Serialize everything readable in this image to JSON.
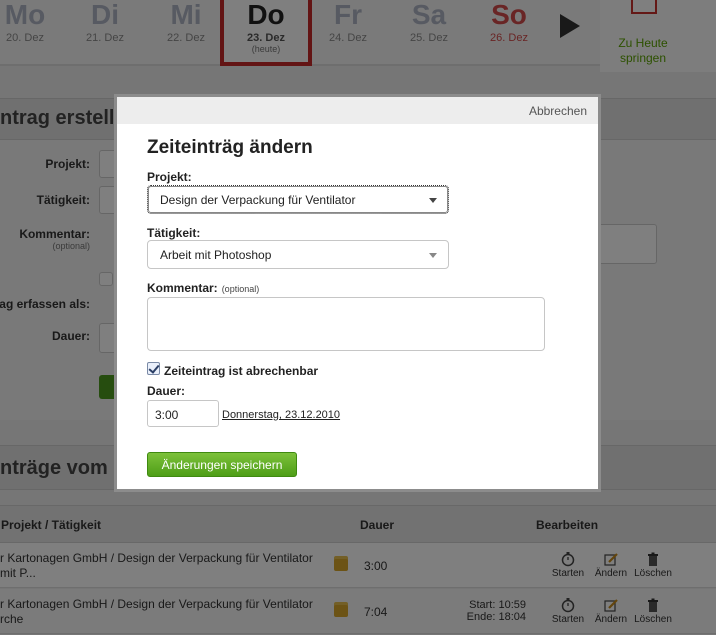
{
  "days": [
    {
      "name": "Mo",
      "date": "20. Dez"
    },
    {
      "name": "Di",
      "date": "21. Dez"
    },
    {
      "name": "Mi",
      "date": "22. Dez"
    },
    {
      "name": "Do",
      "date": "23. Dez",
      "sub": "(heute)"
    },
    {
      "name": "Fr",
      "date": "24. Dez"
    },
    {
      "name": "Sa",
      "date": "25. Dez"
    },
    {
      "name": "So",
      "date": "26. Dez"
    }
  ],
  "today_link": "Zu Heute springen",
  "bg_form": {
    "heading": "ntrag erstelle",
    "labels": {
      "project": "Projekt:",
      "activity": "Tätigkeit:",
      "comment": "Kommentar:",
      "comment_hint": "(optional)",
      "record_as": "ag erfassen als:",
      "duration": "Dauer:"
    }
  },
  "entries_heading": "nträge vom D",
  "table": {
    "headers": {
      "project": "Projekt / Tätigkeit",
      "duration": "Dauer",
      "edit": "Bearbeiten"
    },
    "rows": [
      {
        "project": "r Kartonagen GmbH / Design der Verpackung für Ventilator mit P...",
        "duration": "3:00",
        "start": "",
        "end": ""
      },
      {
        "project": "r Kartonagen GmbH / Design der Verpackung für Ventilator rche",
        "duration": "7:04",
        "start": "Start: 10:59",
        "end": "Ende: 18:04"
      }
    ],
    "actions": {
      "start": "Starten",
      "edit": "Ändern",
      "delete": "Löschen"
    }
  },
  "modal": {
    "cancel": "Abbrechen",
    "title": "Zeiteinträg ändern",
    "project_label": "Projekt:",
    "project_value": "Design der Verpackung für Ventilator",
    "activity_label": "Tätigkeit:",
    "activity_value": "Arbeit mit Photoshop",
    "comment_label": "Kommentar:",
    "comment_hint": "(optional)",
    "comment_value": "",
    "billable_label": "Zeiteintrag ist abrechenbar",
    "billable_checked": true,
    "duration_label": "Dauer:",
    "duration_value": "3:00",
    "date_link": "Donnerstag, 23.12.2010",
    "save_label": "Änderungen speichern"
  },
  "colors": {
    "accent_green": "#5aa300",
    "today_red": "#c62828",
    "sunday_red": "#d24a4a"
  }
}
